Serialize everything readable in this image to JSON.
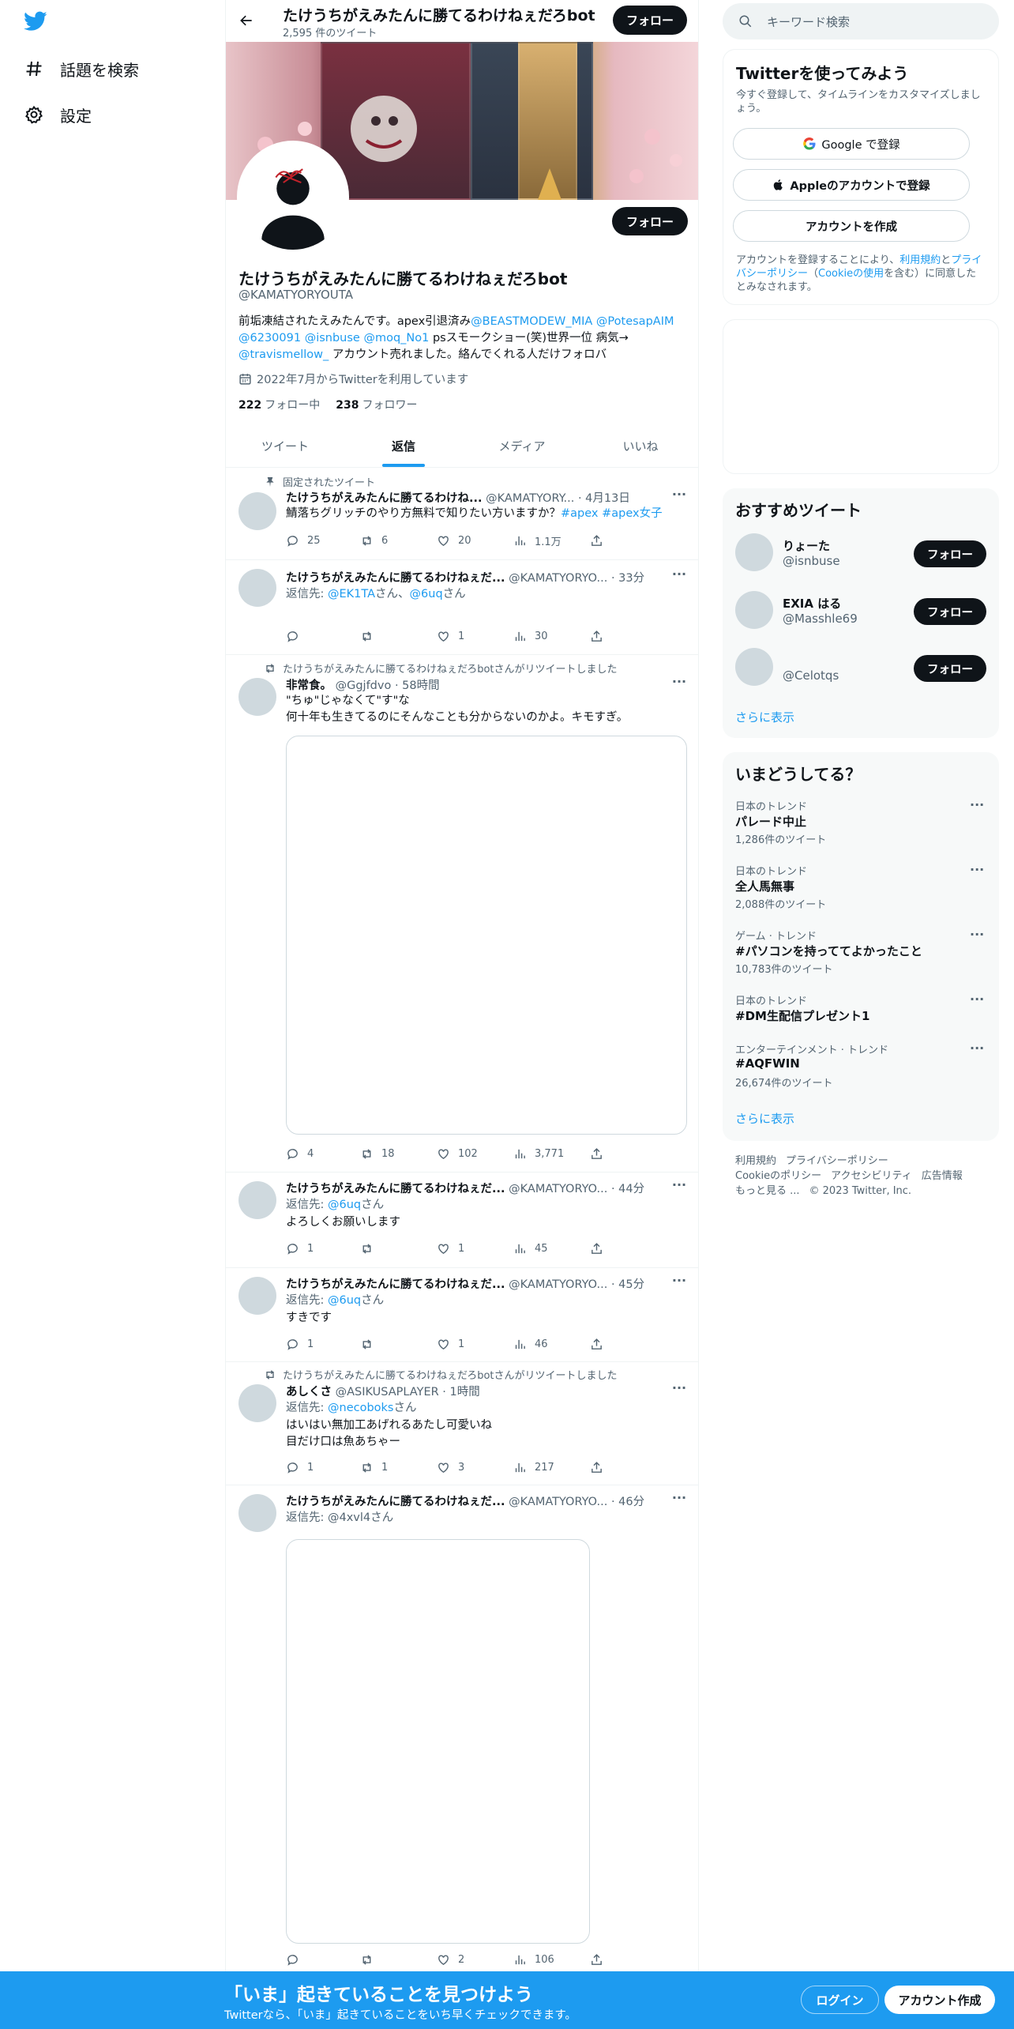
{
  "nav": {
    "explore_label": "話題を検索",
    "settings_label": "設定"
  },
  "profile": {
    "name": "たけうちがえみたんに勝てるわけねぇだろbot",
    "tweet_count": "2,595 件のツイート",
    "follow_label": "フォロー",
    "handle": "@KAMATYORYOUTA",
    "bio": {
      "t1": "前垢凍結されたえみたんです。apex引退済み",
      "m1": "@BEASTMODEW_MIA",
      "m2": "@PotesapAIM",
      "m3": "@6230091",
      "m4": "@isnbuse",
      "m5": "@moq_No1",
      "t2": " psスモークショー(笑)世界一位 病気→ ",
      "m6": "@travismellow_",
      "t3": " アカウント売れました。絡んでくれる人だけフォロバ"
    },
    "joined": "2022年7月からTwitterを利用しています",
    "following_count": "222",
    "following_label": "フォロー中",
    "followers_count": "238",
    "followers_label": "フォロワー"
  },
  "tabs": [
    "ツイート",
    "返信",
    "メディア",
    "いいね"
  ],
  "tweets": [
    {
      "social": "固定されたツイート",
      "name": "たけうちがえみたんに勝てるわけね...",
      "handle": "@KAMATYORY...",
      "time": "· 4月13日",
      "text": "鯖落ちグリッチのやり方無料で知りたい方いますか？",
      "tag1": "#apex",
      "tag2": "#apex女子",
      "reply": "25",
      "retweet": "6",
      "like": "20",
      "views": "1.1万"
    },
    {
      "name": "たけうちがえみたんに勝てるわけねぇだ...",
      "handle": "@KAMATYORYO...",
      "time": "· 33分",
      "replying_prefix": "返信先: ",
      "replying_to_1": "@EK1TA",
      "replying_mid": "さん、",
      "replying_to_2": "@6uq",
      "replying_suffix": "さん",
      "reply": "",
      "retweet": "",
      "like": "1",
      "views": "30"
    },
    {
      "social": "たけうちがえみたんに勝てるわけねぇだろbotさんがリツイートしました",
      "name": "非常食。",
      "handle": "@Ggjfdvo",
      "time": "· 58時間",
      "text_line1": "\"ちゅ\"じゃなくて\"す\"な",
      "text_line2": "何十年も生きてるのにそんなことも分からないのかよ。キモすぎ。",
      "reply": "4",
      "retweet": "18",
      "like": "102",
      "views": "3,771"
    },
    {
      "name": "たけうちがえみたんに勝てるわけねぇだ...",
      "handle": "@KAMATYORYO...",
      "time": "· 44分",
      "replying_prefix": "返信先: ",
      "replying_to_1": "@6uq",
      "replying_suffix": "さん",
      "text": "よろしくお願いします",
      "reply": "1",
      "retweet": "",
      "like": "1",
      "views": "45"
    },
    {
      "name": "たけうちがえみたんに勝てるわけねぇだ...",
      "handle": "@KAMATYORYO...",
      "time": "· 45分",
      "replying_prefix": "返信先: ",
      "replying_to_1": "@6uq",
      "replying_suffix": "さん",
      "text": "すきです",
      "reply": "1",
      "retweet": "",
      "like": "1",
      "views": "46"
    },
    {
      "social": "たけうちがえみたんに勝てるわけねぇだろbotさんがリツイートしました",
      "name": "あしくさ",
      "handle": "@ASIKUSAPLAYER",
      "time": "· 1時間",
      "replying_prefix": "返信先: ",
      "replying_to_1": "@necoboks",
      "replying_suffix": "さん",
      "text_line1": "はいはい無加工あげれるあたし可愛いね",
      "text_line2": "目だけ口は魚あちゃー",
      "reply": "1",
      "retweet": "1",
      "like": "3",
      "views": "217"
    },
    {
      "name": "たけうちがえみたんに勝てるわけねぇだ...",
      "handle": "@KAMATYORYO...",
      "time": "· 46分",
      "replying_plain": "返信先: @4xvl4さん",
      "reply": "",
      "retweet": "",
      "like": "2",
      "views": "106"
    }
  ],
  "search": {
    "placeholder": "キーワード検索"
  },
  "signup": {
    "title": "Twitterを使ってみよう",
    "subtitle": "今すぐ登録して、タイムラインをカスタマイズしましょう。",
    "google": "Google で登録",
    "apple": "Appleのアカウントで登録",
    "create": "アカウントを作成",
    "terms_prefix": "アカウントを登録することにより、",
    "terms_link": "利用規約",
    "terms_and": "と",
    "privacy_link": "プライバシーポリシー",
    "cookie_open": "（",
    "cookie_link": "Cookieの使用",
    "terms_suffix": "を含む）に同意したとみなされます。"
  },
  "recommended": {
    "title": "おすすめツイート",
    "users": [
      {
        "name": "りょーた",
        "handle": "@isnbuse"
      },
      {
        "name": "EXIA はる",
        "handle": "@Masshle69"
      },
      {
        "name": "",
        "handle": "@Celotqs"
      }
    ],
    "follow_label": "フォロー",
    "more": "さらに表示"
  },
  "trends": {
    "title": "いまどうしてる？",
    "items": [
      {
        "category": "日本のトレンド",
        "title": "パレード中止",
        "count": "1,286件のツイート"
      },
      {
        "category": "日本のトレンド",
        "title": "全人馬無事",
        "count": "2,088件のツイート"
      },
      {
        "category": "ゲーム · トレンド",
        "title": "#パソコンを持っててよかったこと",
        "count": "10,783件のツイート"
      },
      {
        "category": "日本のトレンド",
        "title": "#DM生配信プレゼント1",
        "count": ""
      },
      {
        "category": "エンターテインメント · トレンド",
        "title": "#AQFWIN",
        "count": "26,674件のツイート"
      }
    ],
    "more": "さらに表示"
  },
  "footer": {
    "terms": "利用規約",
    "privacy": "プライバシーポリシー",
    "cookie": "Cookieのポリシー",
    "accessibility": "アクセシビリティ",
    "ads": "広告情報",
    "more": "もっと見る ...",
    "copyright": "© 2023 Twitter, Inc."
  },
  "bottombar": {
    "title": "「いま」起きていることを見つけよう",
    "subtitle": "Twitterなら、「いま」起きていることをいち早くチェックできます。",
    "login": "ログイン",
    "signup": "アカウント作成"
  },
  "colors": {
    "accent": "#1d9bf0",
    "text": "#0f1419",
    "secondary": "#536471",
    "border": "#eff3f4"
  }
}
